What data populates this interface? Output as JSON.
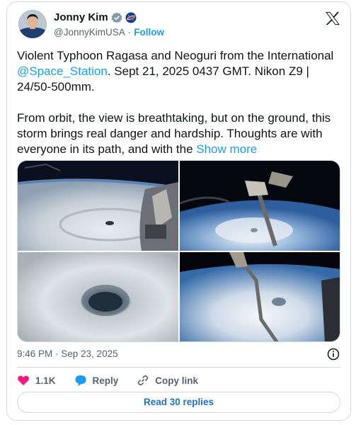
{
  "author": {
    "name": "Jonny Kim",
    "handle": "@JonnyKimUSA",
    "separator": "·",
    "follow_label": "Follow"
  },
  "tweet": {
    "line1_text": "Violent Typhoon Ragasa and Neoguri from the International ",
    "mention": "@Space_Station",
    "line1_rest": ". Sept 21, 2025 0437 GMT. Nikon Z9 | 24/50-500mm.",
    "para2_text": "From orbit, the view is breathtaking, but on the ground, this storm brings real danger and hardship. Thoughts are with everyone in its path, and with the ",
    "show_more": "Show more"
  },
  "media": {
    "images": [
      "typhoon-eye-wide",
      "iss-arm-over-typhoon",
      "typhoon-eye-closeup",
      "typhoon-with-station-arm"
    ]
  },
  "meta": {
    "timestamp": "9:46 PM · Sep 23, 2025"
  },
  "actions": {
    "like_count": "1.1K",
    "reply_label": "Reply",
    "copy_link_label": "Copy link"
  },
  "read_replies": "Read 30 replies",
  "colors": {
    "accent": "#1d9bf0",
    "like": "#f91880",
    "reply_bubble": "#1d9bf0",
    "text": "#0f1419",
    "muted": "#536471",
    "border": "#cfd9de"
  }
}
